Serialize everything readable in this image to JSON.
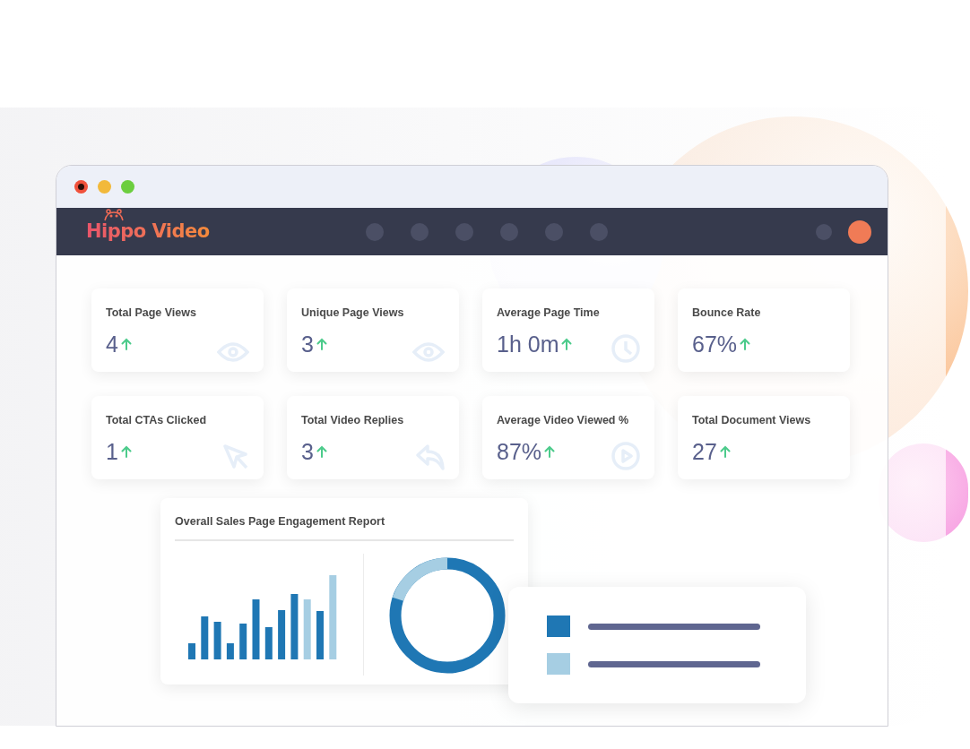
{
  "window": {
    "controls": [
      {
        "kind": "close"
      },
      {
        "kind": "minimize"
      },
      {
        "kind": "zoom"
      }
    ]
  },
  "navbar": {
    "logo": "Hippo Video"
  },
  "cards": [
    {
      "label": "Total Page Views",
      "value": "4",
      "kind": "eye"
    },
    {
      "label": "Unique Page Views",
      "value": "3",
      "kind": "eye"
    },
    {
      "label": "Average Page Time",
      "value": "1h 0m",
      "kind": "clock"
    },
    {
      "label": "Bounce Rate",
      "value": "67%",
      "kind": "plain"
    },
    {
      "label": "Total CTAs Clicked",
      "value": "1",
      "kind": "cursor"
    },
    {
      "label": "Total Video Replies",
      "value": "3",
      "kind": "reply"
    },
    {
      "label": "Average Video Viewed %",
      "value": "87%",
      "kind": "play"
    },
    {
      "label": "Total Document Views",
      "value": "27",
      "kind": "plain"
    }
  ],
  "report": {
    "title": "Overall Sales Page Engagement Report"
  },
  "legend": [
    {
      "color": "#1f77b4"
    },
    {
      "color": "#a6cee3"
    }
  ]
}
